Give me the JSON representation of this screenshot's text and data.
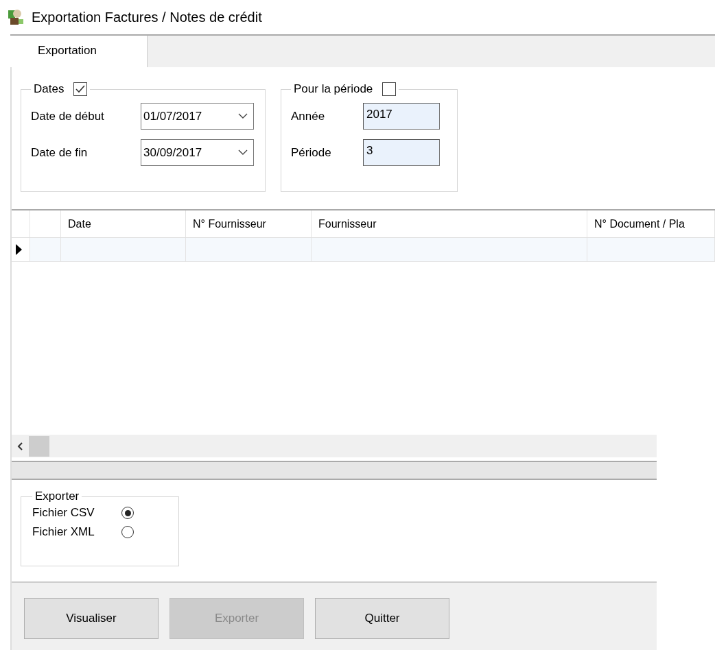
{
  "window": {
    "title": "Exportation Factures / Notes de crédit"
  },
  "tabs": [
    {
      "label": "Exportation",
      "selected": true
    }
  ],
  "dates_group": {
    "label": "Dates",
    "checked": true,
    "fields": [
      {
        "label": "Date de début",
        "value": "01/07/2017"
      },
      {
        "label": "Date de fin",
        "value": "30/09/2017"
      }
    ]
  },
  "period_group": {
    "label": "Pour la période",
    "checked": false,
    "fields": [
      {
        "label": "Année",
        "value": "2017"
      },
      {
        "label": "Période",
        "value": "3"
      }
    ]
  },
  "table": {
    "columns": [
      "Date",
      "N° Fournisseur",
      "Fournisseur",
      "N° Document / Pla"
    ],
    "rows": [
      {
        "current": true
      }
    ]
  },
  "export_group": {
    "label": "Exporter",
    "options": [
      {
        "label": "Fichier CSV",
        "selected": true
      },
      {
        "label": "Fichier XML",
        "selected": false
      }
    ]
  },
  "buttons": [
    {
      "label": "Visualiser",
      "disabled": false
    },
    {
      "label": "Exporter",
      "disabled": true
    },
    {
      "label": "Quitter",
      "disabled": false
    }
  ]
}
